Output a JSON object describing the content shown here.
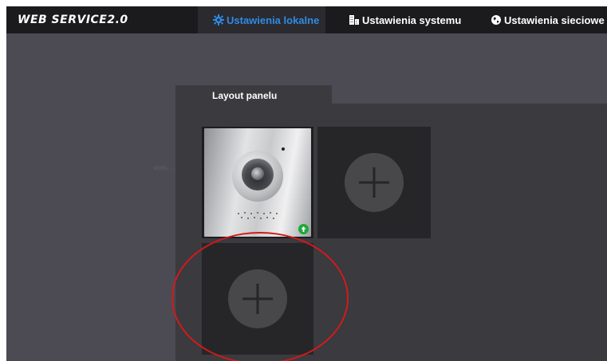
{
  "header": {
    "brand": "WEB SERVICE2.0",
    "tabs": [
      {
        "label": "Ustawienia lokalne",
        "icon": "gear-icon",
        "active": true
      },
      {
        "label": "Ustawienia systemu",
        "icon": "building-icon",
        "active": false
      },
      {
        "label": "Ustawienia sieciowe",
        "icon": "globe-icon",
        "active": false
      }
    ]
  },
  "panel": {
    "tab_label": "Layout panelu",
    "slots": [
      {
        "type": "camera-module",
        "status": "ok"
      },
      {
        "type": "empty",
        "action": "add"
      },
      {
        "type": "empty",
        "action": "add",
        "highlighted": true
      }
    ]
  },
  "watermark": "www.…",
  "colors": {
    "accent": "#2f8be6",
    "background": "#4c4a53",
    "topbar": "#1b1b1d",
    "content": "#3a3a3f",
    "status_ok": "#1fa83a",
    "annotation": "#d21a1a"
  }
}
